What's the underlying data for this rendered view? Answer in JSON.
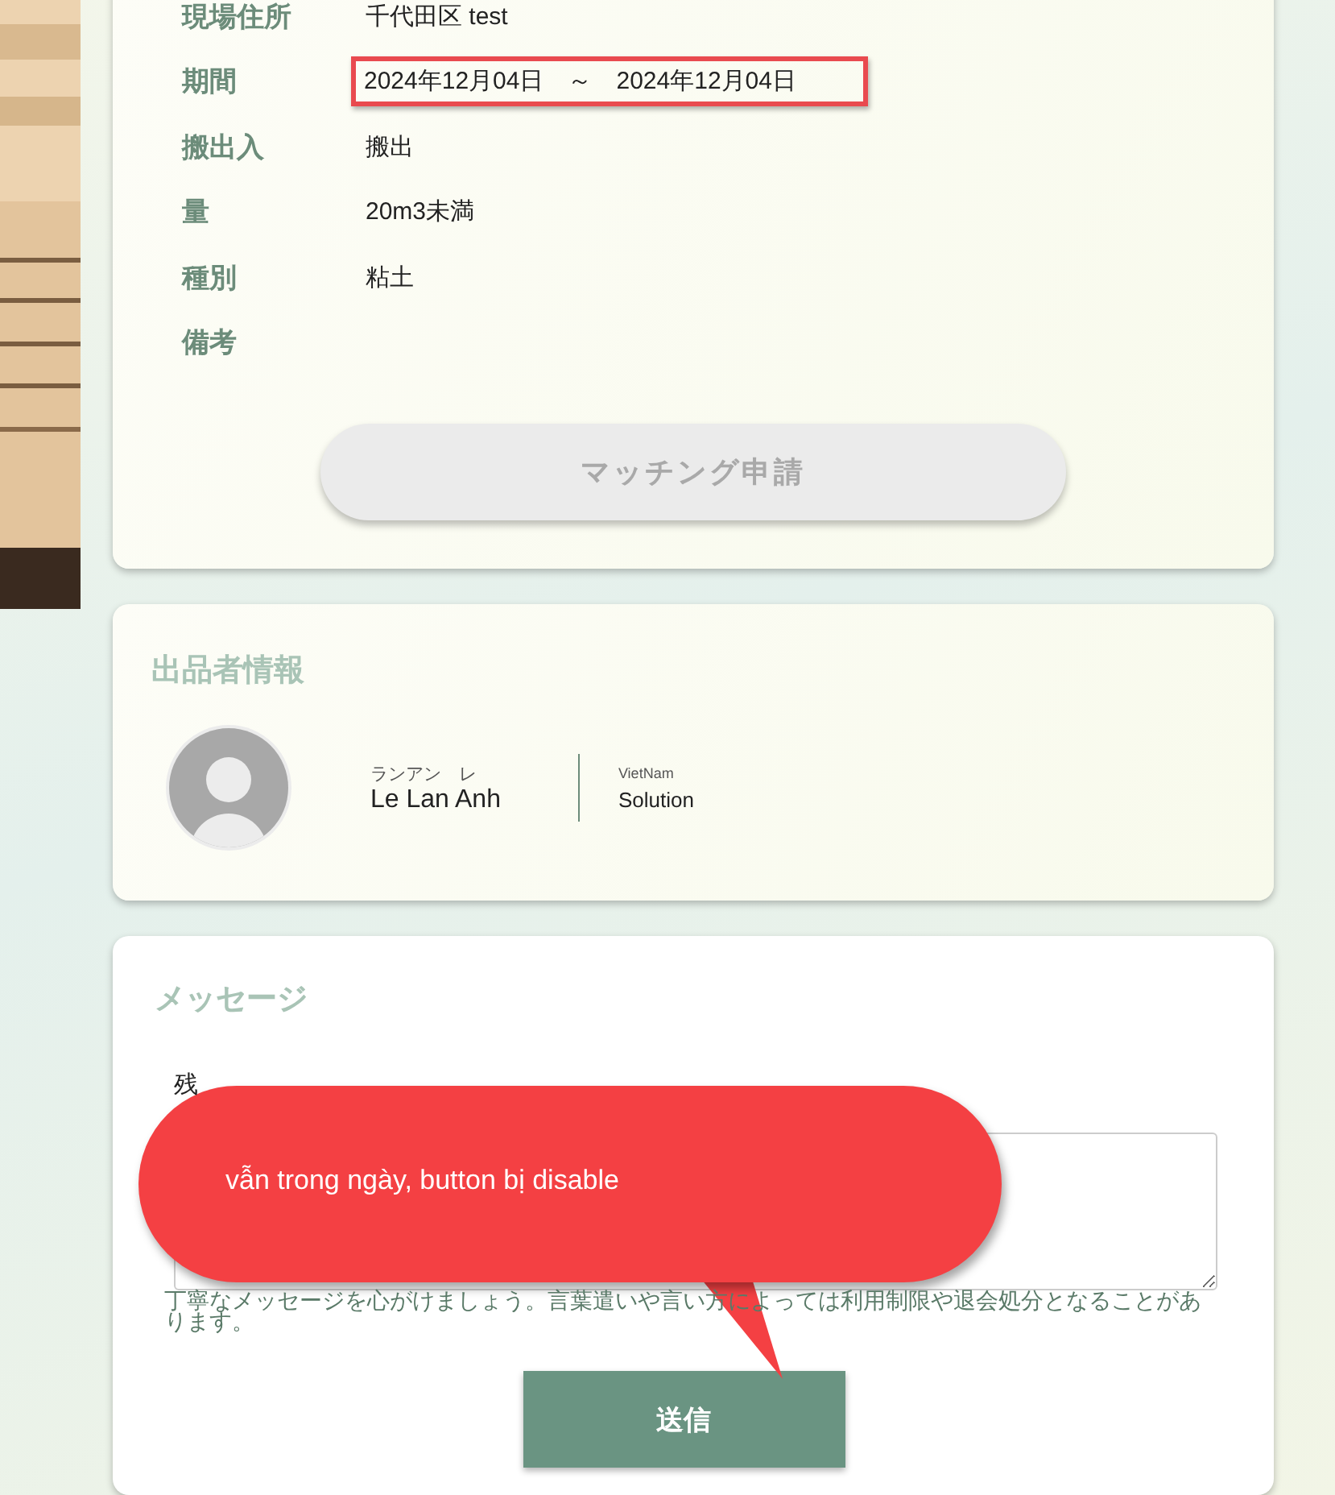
{
  "details": [
    {
      "label": "現場住所",
      "value": "千代田区 test",
      "highlighted": false
    },
    {
      "label": "期間",
      "value": "2024年12月04日　～　2024年12月04日",
      "highlighted": true
    },
    {
      "label": "搬出入",
      "value": "搬出",
      "highlighted": false
    },
    {
      "label": "量",
      "value": "20m3未満",
      "highlighted": false
    },
    {
      "label": "種別",
      "value": "粘土",
      "highlighted": false
    },
    {
      "label": "備考",
      "highlighted": false
    }
  ],
  "match_button": {
    "label": "マッチング申請",
    "disabled": true
  },
  "seller": {
    "title": "出品者情報",
    "name_kana": "ランアン　レ",
    "name": "Le  Lan Anh",
    "company_sub": "VietNam",
    "company": "Solution"
  },
  "message": {
    "title": "メッセージ",
    "remaining": "残",
    "hint": "丁寧なメッセージを心がけましょう。言葉遣いや言い方によっては利用制限や退会処分となることがあります。",
    "send_label": "送信"
  },
  "callout": {
    "text": "vẫn trong ngày, button bị disable"
  }
}
